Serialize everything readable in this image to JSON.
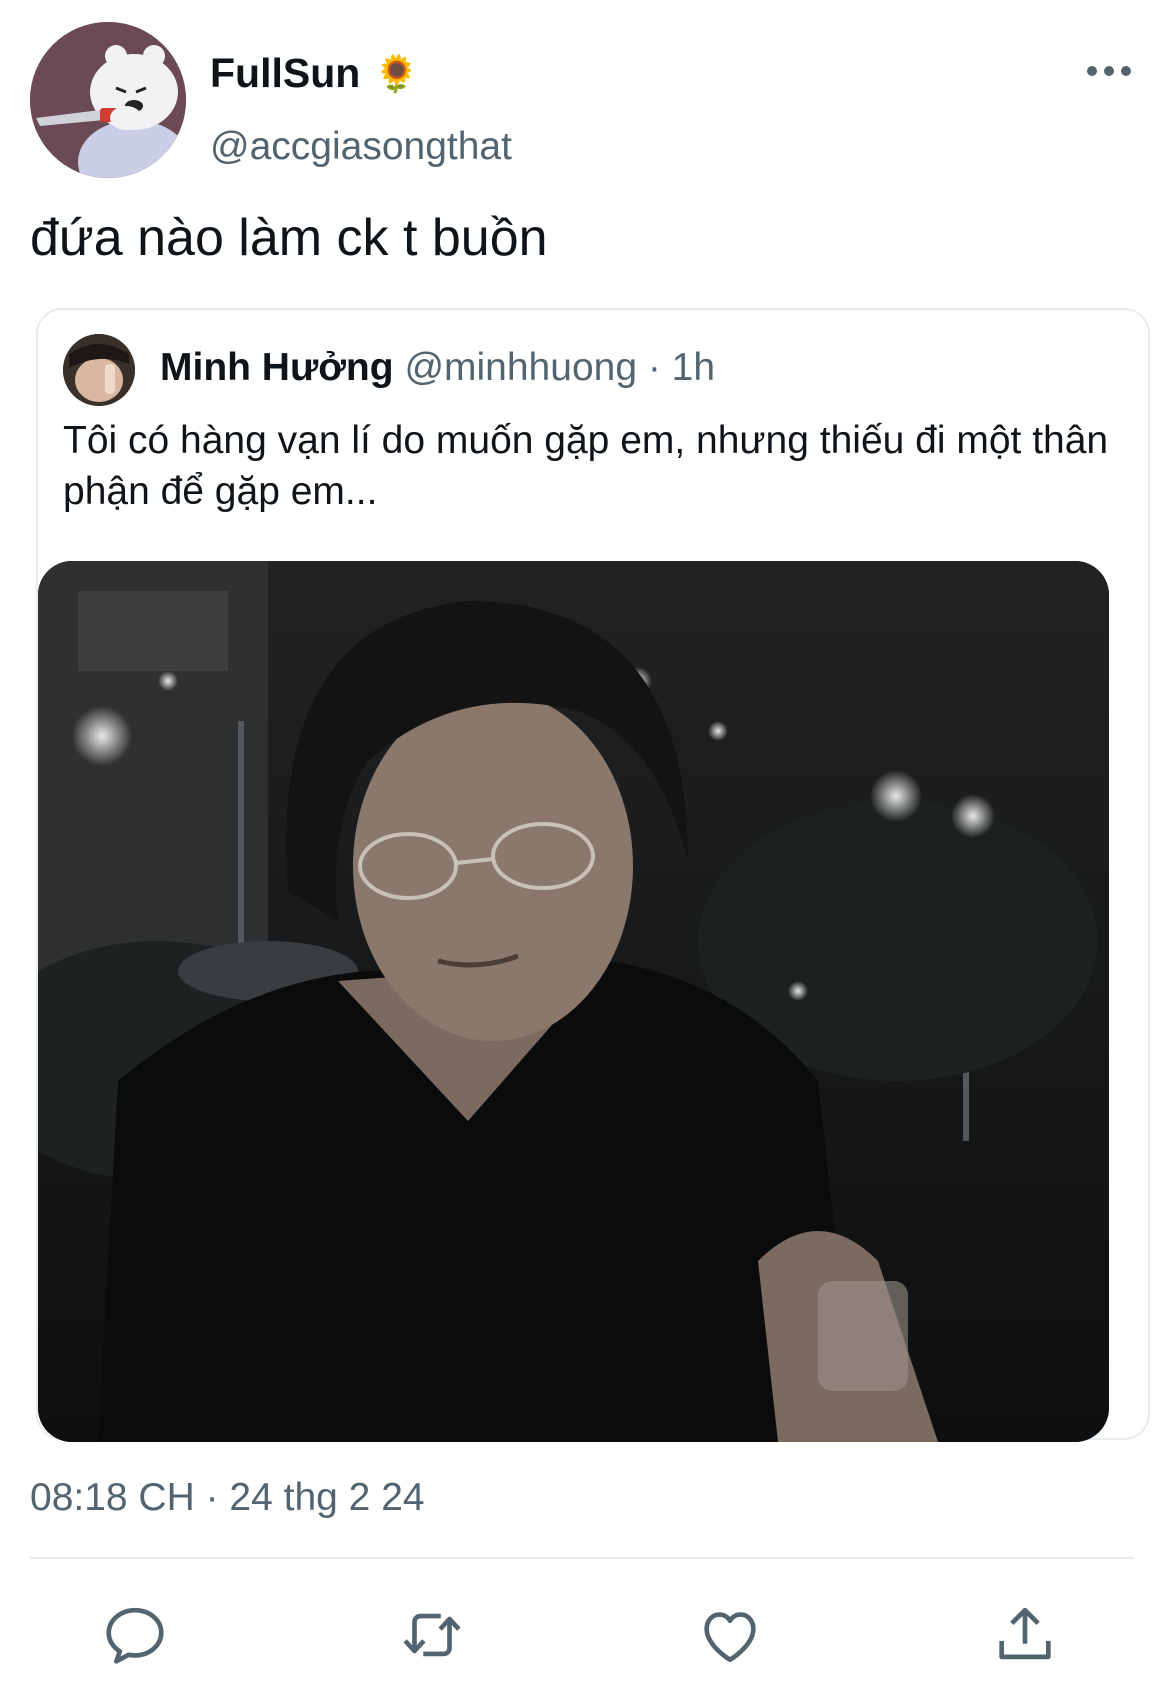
{
  "author": {
    "display_name": "FullSun",
    "emoji": "🌻",
    "handle": "@accgiasongthat",
    "avatar_icon": "cartoon-bear-avatar"
  },
  "tweet": {
    "text": "đứa nào làm ck t buồn",
    "timestamp": "08:18 CH · 24 thg 2 24"
  },
  "quoted": {
    "display_name": "Minh Hưởng",
    "handle": "@minhhuong",
    "time": " · 1h",
    "text": "Tôi có hàng vạn lí do muốn gặp em, nhưng thiếu đi một thân phận để gặp em...",
    "media_icon": "night-portrait-photo"
  },
  "actions": [
    {
      "icon": "reply-icon"
    },
    {
      "icon": "retweet-icon"
    },
    {
      "icon": "like-icon"
    },
    {
      "icon": "share-icon"
    }
  ],
  "colors": {
    "primary_text": "#0f1419",
    "secondary_text": "#536471",
    "border": "#e6ecf0",
    "icon": "#536471"
  }
}
